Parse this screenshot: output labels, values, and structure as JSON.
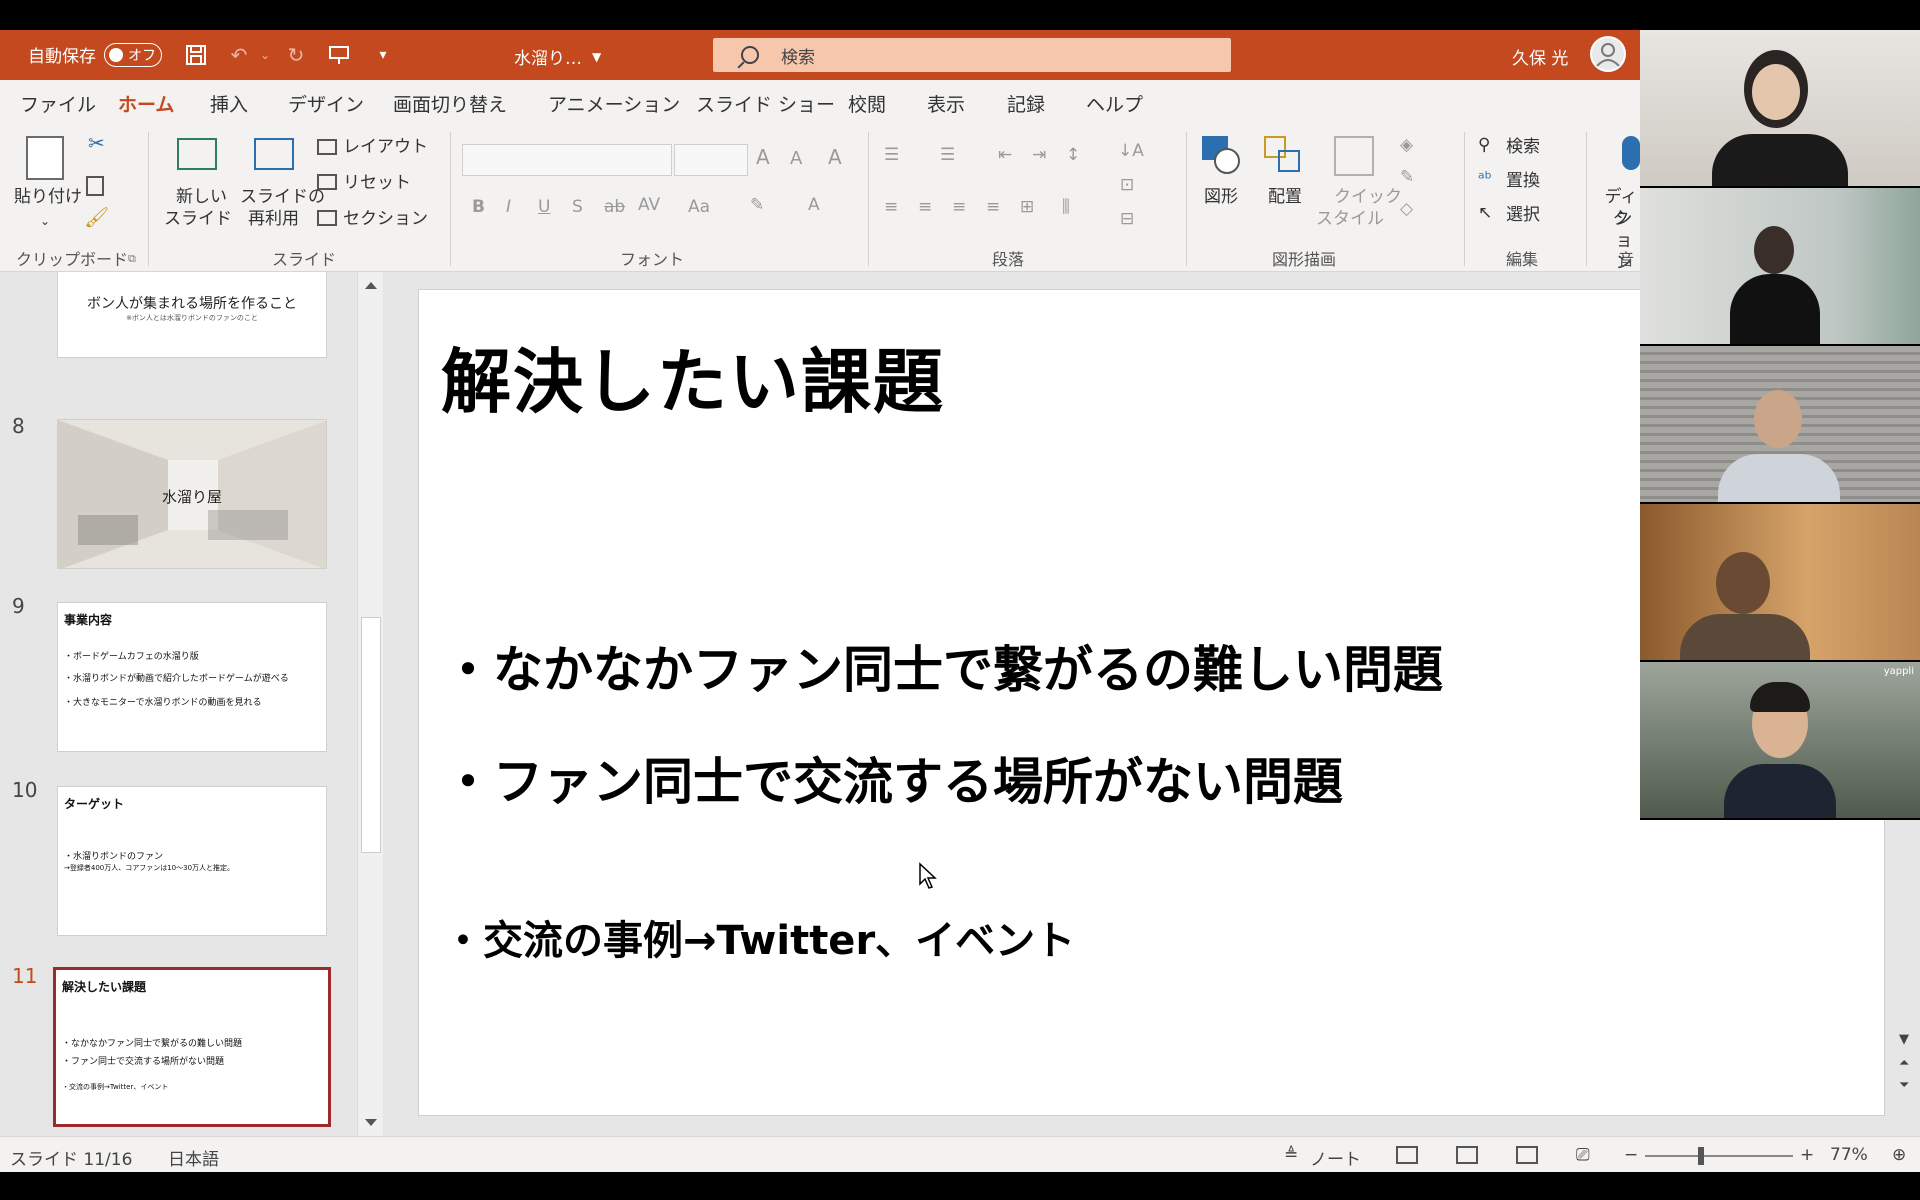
{
  "titlebar": {
    "autosave_label": "自動保存",
    "autosave_state": "オフ",
    "doc_title": "水溜り…",
    "search_text": "検索",
    "user_name": "久保 光"
  },
  "menu": {
    "tabs": [
      "ファイル",
      "ホーム",
      "挿入",
      "デザイン",
      "画面切り替え",
      "アニメーション",
      "スライド ショー",
      "校閲",
      "表示",
      "記録",
      "ヘルプ"
    ]
  },
  "ribbon": {
    "paste": "貼り付け",
    "new_slide_1": "新しい",
    "new_slide_2": "スライド",
    "reuse_1": "スライドの",
    "reuse_2": "再利用",
    "layout": "レイアウト",
    "reset": "リセット",
    "section": "セクション",
    "shapes": "図形",
    "arrange": "配置",
    "quick_1": "クイック",
    "quick_2": "スタイル",
    "find": "検索",
    "replace": "置換",
    "select": "選択",
    "dictate_1": "ディク",
    "dictate_2": "ション",
    "groups": {
      "clipboard": "クリップボード",
      "slides": "スライド",
      "font": "フォント",
      "paragraph": "段落",
      "drawing": "図形描画",
      "editing": "編集",
      "voice": "音声"
    }
  },
  "thumbnails": {
    "slide7_text": "ボン人が集まれる場所を作ること",
    "slide7_sub": "※ボン人とは水溜りボンドのファンのこと",
    "slide8_num": "8",
    "slide8_text": "水溜り屋",
    "slide9_num": "9",
    "slide9_title": "事業内容",
    "slide9_lines": [
      "・ボードゲームカフェの水溜り版",
      "・水溜りボンドが動画で紹介したボードゲームが遊べる",
      "・大きなモニターで水溜りボンドの動画を見れる"
    ],
    "slide10_num": "10",
    "slide10_title": "ターゲット",
    "slide10_lines": [
      "・水溜りボンドのファン",
      "→登録者400万人、コアファンは10〜30万人と推定。"
    ],
    "slide11_num": "11",
    "slide11_title": "解決したい課題",
    "slide11_lines": [
      "・なかなかファン同士で繋がるの難しい問題",
      "・ファン同士で交流する場所がない問題",
      "・交流の事例→Twitter、イベント"
    ]
  },
  "slide": {
    "title": "解決したい課題",
    "bullet1": "・なかなかファン同士で繋がるの難しい問題",
    "bullet2": "・ファン同士で交流する場所がない問題",
    "bullet3": "・交流の事例→Twitter、イベント"
  },
  "status": {
    "slide_counter": "スライド 11/16",
    "language": "日本語",
    "notes": "ノート",
    "zoom": "77%"
  },
  "participants": {
    "overlay_label": "yappli"
  },
  "colors": {
    "accent": "#c4491f",
    "selected_thumb_border": "#9c2a2a"
  }
}
